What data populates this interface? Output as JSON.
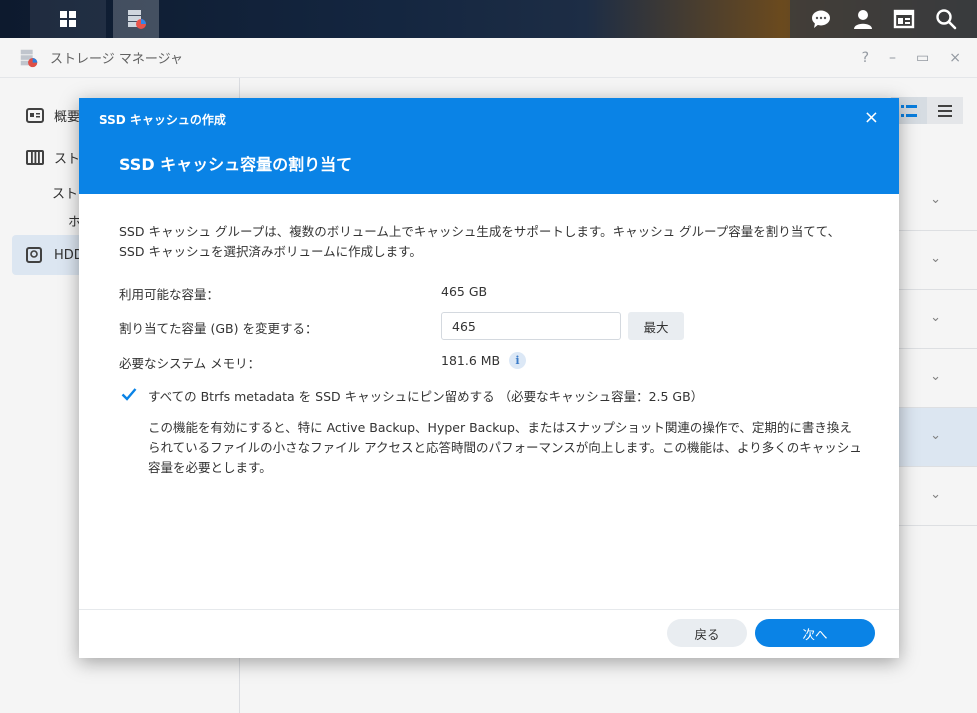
{
  "app": {
    "title": "ストレージ マネージャ",
    "window_controls": [
      "?",
      "–",
      "▭",
      "×"
    ]
  },
  "taskbar": {
    "left_icons": [
      "apps-grid-icon",
      "storage-manager-icon"
    ],
    "right_icons": [
      "chat-icon",
      "user-icon",
      "widgets-icon",
      "search-icon"
    ]
  },
  "sidebar": {
    "items": [
      {
        "label": "概要"
      },
      {
        "label": "スト"
      },
      {
        "label": "スト"
      },
      {
        "label": "ホ"
      },
      {
        "label": "HDD"
      }
    ]
  },
  "dialog": {
    "window_title": "SSD キャッシュの作成",
    "close": "×",
    "title": "SSD キャッシュ容量の割り当て",
    "description": "SSD キャッシュ グループは、複数のボリューム上でキャッシュ生成をサポートします。キャッシュ グループ容量を割り当てて、SSD キャッシュを選択済みボリュームに作成します。",
    "available_label": "利用可能な容量：",
    "available_value": "465 GB",
    "alloc_label": "割り当てた容量 (GB) を変更する：",
    "alloc_value": "465",
    "max_button": "最大",
    "memory_label": "必要なシステム メモリ：",
    "memory_value": "181.6 MB",
    "info_icon": "i",
    "pin_checkbox_label": "すべての Btrfs metadata を SSD キャッシュにピン留めする （必要なキャッシュ容量：2.5 GB）",
    "pin_checked": true,
    "pin_description": "この機能を有効にすると、特に Active Backup、Hyper Backup、またはスナップショット関連の操作で、定期的に書き換えられているファイルの小さなファイル アクセスと応答時間のパフォーマンスが向上します。この機能は、より多くのキャッシュ容量を必要とします。",
    "back_button": "戻る",
    "next_button": "次へ"
  },
  "colors": {
    "accent": "#0a83e6",
    "selected_bg": "#e5f0fb"
  }
}
